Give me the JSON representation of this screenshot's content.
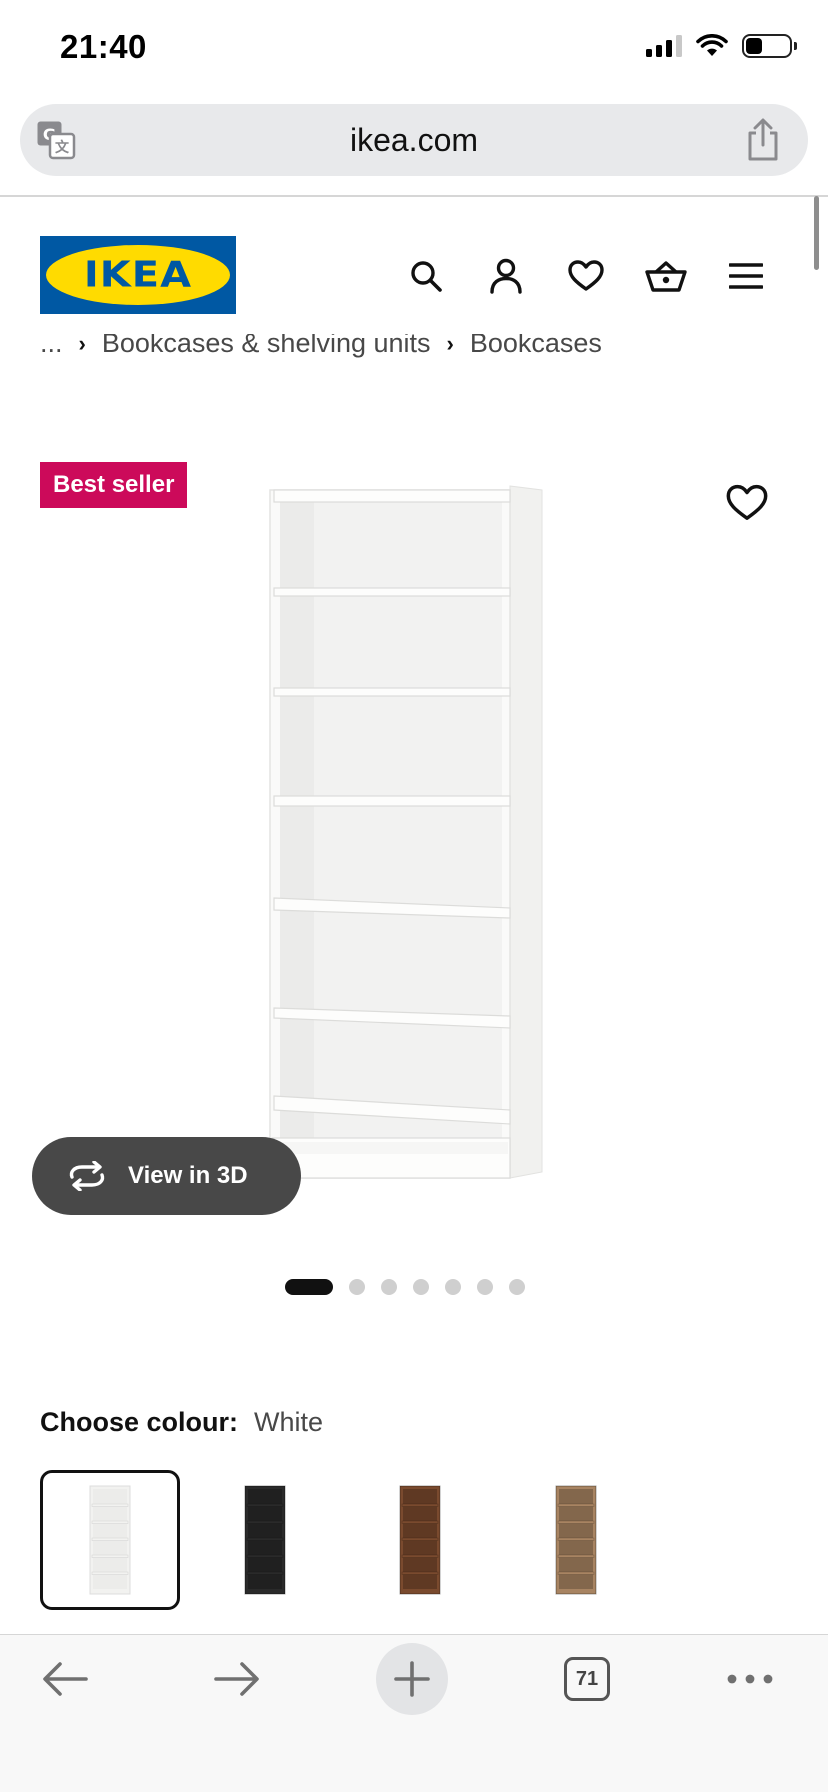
{
  "status_bar": {
    "time": "21:40",
    "icons": [
      "cellular-signal-icon",
      "wifi-icon",
      "battery-icon"
    ]
  },
  "browser": {
    "url": "ikea.com",
    "translate_icon": "translate-icon",
    "share_icon": "share-icon",
    "tab_count": "71",
    "toolbar_icons": [
      "back-arrow-icon",
      "forward-arrow-icon",
      "new-tab-plus-icon",
      "tabs-icon",
      "more-icon"
    ]
  },
  "header": {
    "logo_text": "IKEA",
    "brand_colors": {
      "blue": "#0058a3",
      "yellow": "#ffdb00"
    },
    "nav_icons": [
      "search-icon",
      "profile-icon",
      "favourites-heart-icon",
      "shopping-basket-icon",
      "hamburger-menu-icon"
    ]
  },
  "breadcrumb": {
    "ellipsis": "...",
    "items": [
      "Bookcases & shelving units",
      "Bookcases"
    ]
  },
  "product": {
    "badge": "Best seller",
    "badge_color": "#cc0a5a",
    "view_3d_label": "View in 3D",
    "image_count": 7,
    "active_image_index": 0
  },
  "colour": {
    "label": "Choose colour:",
    "selected": "White",
    "swatches": [
      {
        "name": "White",
        "color": "#f2f2f0",
        "selected": true
      },
      {
        "name": "Black-brown",
        "color": "#2a2a2a",
        "selected": false
      },
      {
        "name": "Brown walnut",
        "color": "#7a4a2e",
        "selected": false
      },
      {
        "name": "Oak",
        "color": "#a88462",
        "selected": false
      }
    ]
  }
}
